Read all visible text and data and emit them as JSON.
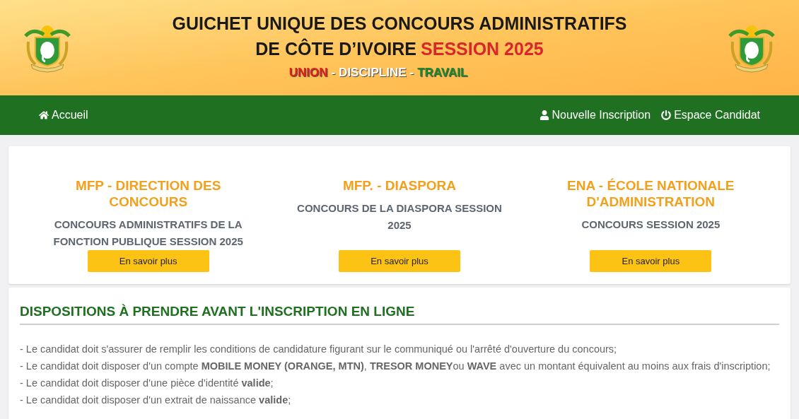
{
  "header": {
    "title_line_1": "GUICHET UNIQUE DES CONCOURS ADMINISTRATIFS",
    "title_line_2": "DE CÔTE D’IVOIRE",
    "session": "SESSION 2025",
    "motto": [
      {
        "text": "UNION",
        "color": "#e3201b"
      },
      {
        "text": "-",
        "color": "#ffffff"
      },
      {
        "text": "DISCIPLINE",
        "color": "#ffffff"
      },
      {
        "text": "-",
        "color": "#ffffff"
      },
      {
        "text": "TRAVAIL",
        "color": "#1f8a2a"
      }
    ]
  },
  "nav": {
    "left": [
      {
        "label": "Accueil",
        "kind": "home"
      }
    ],
    "right": [
      {
        "label": "Nouvelle Inscription",
        "kind": "user"
      },
      {
        "label": "Espace Candidat",
        "kind": "power"
      }
    ]
  },
  "cards": [
    {
      "title": "MFP - DIRECTION DES CONCOURS",
      "subtitle": "CONCOURS ADMINISTRATIFS DE LA FONCTION PUBLIQUE SESSION 2025",
      "button": "En savoir plus"
    },
    {
      "title": "MFP. - DIASPORA",
      "subtitle": "CONCOURS DE LA DIASPORA SESSION 2025",
      "button": "En savoir plus"
    },
    {
      "title": "ENA - ÉCOLE NATIONALE D'ADMINISTRATION",
      "subtitle": "CONCOURS SESSION 2025",
      "button": "En savoir plus"
    }
  ],
  "dispositions": {
    "heading": "DISPOSITIONS À PRENDRE AVANT L'INSCRIPTION EN LIGNE",
    "items": [
      "- Le candidat doit s'assurer de remplir les conditions de candidature figurant sur le communiqué ou l'arrêté d'ouverture du concours;",
      "- Le candidat doit disposer d'un compte **MOBILE MONEY (ORANGE, MTN)**, **TRESOR MONEY**ou **WAVE** avec un montant équivalent au moins aux frais d'inscription;",
      "- Le candidat doit disposer d'une pièce d'identité **valide**;",
      "- Le candidat doit disposer d'un extrait de naissance **valide**;"
    ]
  }
}
